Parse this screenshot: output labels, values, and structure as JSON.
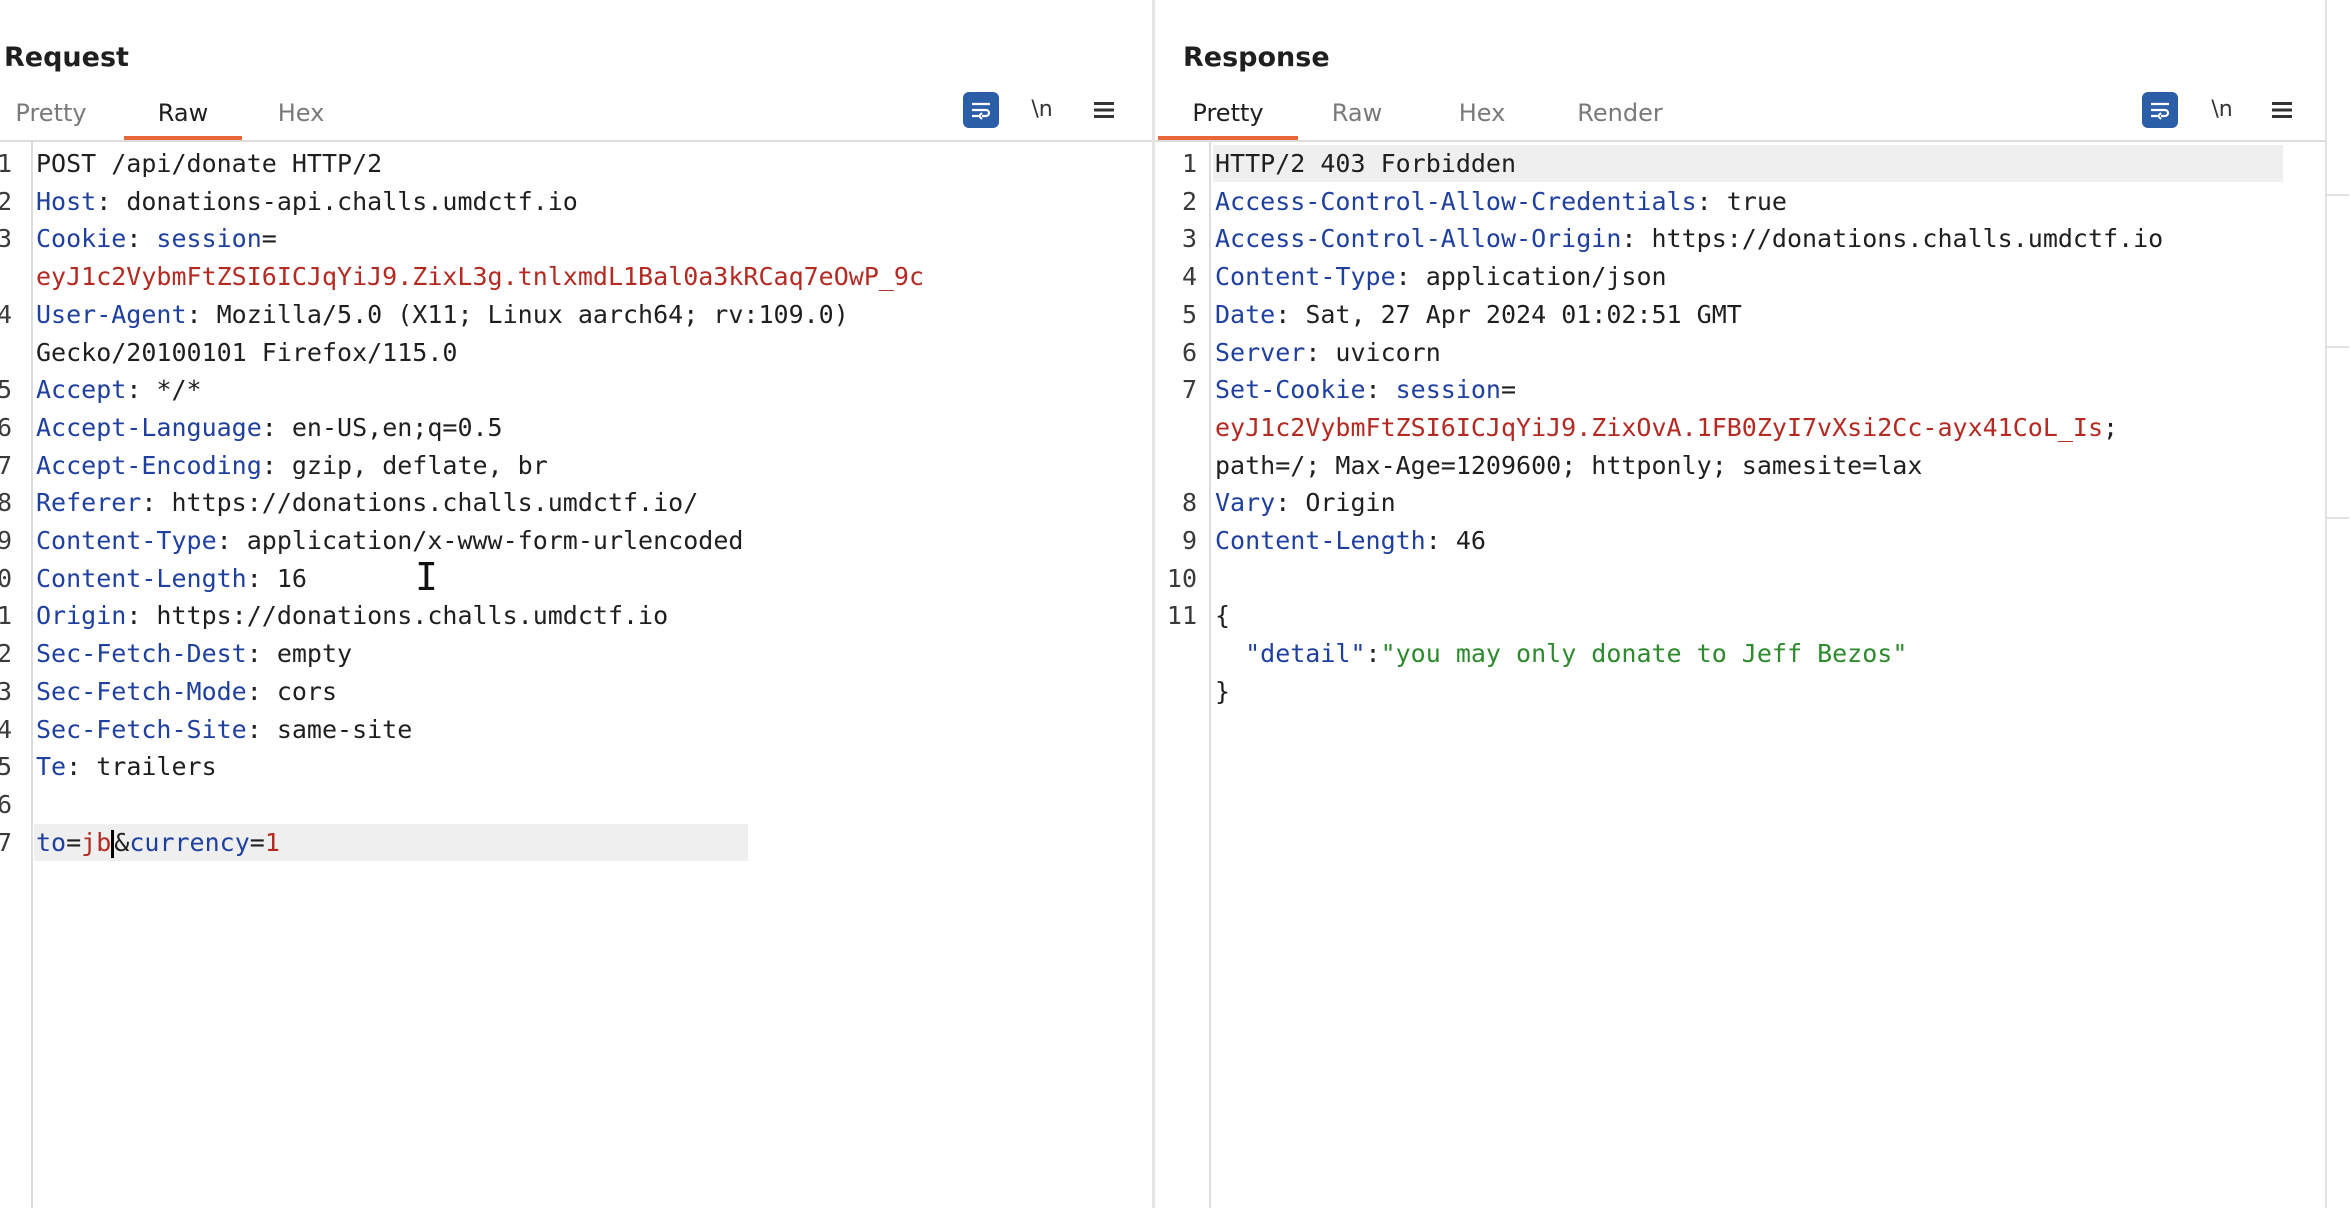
{
  "layout_switch": {
    "options": [
      "side-by-side-layout-icon",
      "stacked-layout-icon",
      "single-pane-layout-icon"
    ],
    "active_index": 0,
    "accent_color": "#2b5ea7"
  },
  "request": {
    "title": "Request",
    "tabs": [
      {
        "label": "Pretty",
        "active": false
      },
      {
        "label": "Raw",
        "active": true
      },
      {
        "label": "Hex",
        "active": false
      }
    ],
    "toolbar": {
      "wrap_icon": "wrap-lines-icon",
      "newline_label": "\\n",
      "menu_icon": "hamburger-menu-icon"
    },
    "lines": [
      {
        "num": "1",
        "segments": [
          {
            "t": "POST /api/donate HTTP/2",
            "c": "v"
          }
        ]
      },
      {
        "num": "2",
        "segments": [
          {
            "t": "Host",
            "c": "k"
          },
          {
            "t": ": donations-api.challs.umdctf.io",
            "c": "v"
          }
        ]
      },
      {
        "num": "3",
        "segments": [
          {
            "t": "Cookie",
            "c": "k"
          },
          {
            "t": ": ",
            "c": "v"
          },
          {
            "t": "session",
            "c": "k"
          },
          {
            "t": "=",
            "c": "v"
          }
        ]
      },
      {
        "num": "",
        "segments": [
          {
            "t": "eyJ1c2VybmFtZSI6ICJqYiJ9.ZixL3g.tnlxmdL1Bal0a3kRCaq7eOwP_9c",
            "c": "r"
          }
        ]
      },
      {
        "num": "4",
        "segments": [
          {
            "t": "User-Agent",
            "c": "k"
          },
          {
            "t": ": Mozilla/5.0 (X11; Linux aarch64; rv:109.0)",
            "c": "v"
          }
        ]
      },
      {
        "num": "",
        "segments": [
          {
            "t": "Gecko/20100101 Firefox/115.0",
            "c": "v"
          }
        ]
      },
      {
        "num": "5",
        "segments": [
          {
            "t": "Accept",
            "c": "k"
          },
          {
            "t": ": */*",
            "c": "v"
          }
        ]
      },
      {
        "num": "6",
        "segments": [
          {
            "t": "Accept-Language",
            "c": "k"
          },
          {
            "t": ": en-US,en;q=0.5",
            "c": "v"
          }
        ]
      },
      {
        "num": "7",
        "segments": [
          {
            "t": "Accept-Encoding",
            "c": "k"
          },
          {
            "t": ": gzip, deflate, br",
            "c": "v"
          }
        ]
      },
      {
        "num": "8",
        "segments": [
          {
            "t": "Referer",
            "c": "k"
          },
          {
            "t": ": https://donations.challs.umdctf.io/",
            "c": "v"
          }
        ]
      },
      {
        "num": "9",
        "segments": [
          {
            "t": "Content-Type",
            "c": "k"
          },
          {
            "t": ": application/x-www-form-urlencoded",
            "c": "v"
          }
        ]
      },
      {
        "num": "0",
        "segments": [
          {
            "t": "Content-Length",
            "c": "k"
          },
          {
            "t": ": 16",
            "c": "v"
          }
        ]
      },
      {
        "num": "1",
        "segments": [
          {
            "t": "Origin",
            "c": "k"
          },
          {
            "t": ": https://donations.challs.umdctf.io",
            "c": "v"
          }
        ]
      },
      {
        "num": "2",
        "segments": [
          {
            "t": "Sec-Fetch-Dest",
            "c": "k"
          },
          {
            "t": ": empty",
            "c": "v"
          }
        ]
      },
      {
        "num": "3",
        "segments": [
          {
            "t": "Sec-Fetch-Mode",
            "c": "k"
          },
          {
            "t": ": cors",
            "c": "v"
          }
        ]
      },
      {
        "num": "4",
        "segments": [
          {
            "t": "Sec-Fetch-Site",
            "c": "k"
          },
          {
            "t": ": same-site",
            "c": "v"
          }
        ]
      },
      {
        "num": "5",
        "segments": [
          {
            "t": "Te",
            "c": "k"
          },
          {
            "t": ": trailers",
            "c": "v"
          }
        ]
      },
      {
        "num": "6",
        "segments": []
      },
      {
        "num": "7",
        "highlight": true,
        "segments": [
          {
            "t": "to",
            "c": "k"
          },
          {
            "t": "=",
            "c": "v"
          },
          {
            "t": "jb",
            "c": "r"
          },
          {
            "t": "&",
            "c": "v",
            "caret_before": true
          },
          {
            "t": "currency",
            "c": "k"
          },
          {
            "t": "=",
            "c": "v"
          },
          {
            "t": "1",
            "c": "r"
          }
        ]
      }
    ]
  },
  "response": {
    "title": "Response",
    "tabs": [
      {
        "label": "Pretty",
        "active": true
      },
      {
        "label": "Raw",
        "active": false
      },
      {
        "label": "Hex",
        "active": false
      },
      {
        "label": "Render",
        "active": false
      }
    ],
    "toolbar": {
      "wrap_icon": "wrap-lines-icon",
      "newline_label": "\\n",
      "menu_icon": "hamburger-menu-icon"
    },
    "lines": [
      {
        "num": "1",
        "highlight": true,
        "segments": [
          {
            "t": "HTTP/2 403 Forbidden",
            "c": "v"
          }
        ]
      },
      {
        "num": "2",
        "segments": [
          {
            "t": "Access-Control-Allow-Credentials",
            "c": "k"
          },
          {
            "t": ": true",
            "c": "v"
          }
        ]
      },
      {
        "num": "3",
        "segments": [
          {
            "t": "Access-Control-Allow-Origin",
            "c": "k"
          },
          {
            "t": ": https://donations.challs.umdctf.io",
            "c": "v"
          }
        ]
      },
      {
        "num": "4",
        "segments": [
          {
            "t": "Content-Type",
            "c": "k"
          },
          {
            "t": ": application/json",
            "c": "v"
          }
        ]
      },
      {
        "num": "5",
        "segments": [
          {
            "t": "Date",
            "c": "k"
          },
          {
            "t": ": Sat, 27 Apr 2024 01:02:51 GMT",
            "c": "v"
          }
        ]
      },
      {
        "num": "6",
        "segments": [
          {
            "t": "Server",
            "c": "k"
          },
          {
            "t": ": uvicorn",
            "c": "v"
          }
        ]
      },
      {
        "num": "7",
        "segments": [
          {
            "t": "Set-Cookie",
            "c": "k"
          },
          {
            "t": ": ",
            "c": "v"
          },
          {
            "t": "session",
            "c": "k"
          },
          {
            "t": "=",
            "c": "v"
          }
        ]
      },
      {
        "num": "",
        "segments": [
          {
            "t": "eyJ1c2VybmFtZSI6ICJqYiJ9.ZixOvA.1FB0ZyI7vXsi2Cc-ayx41CoL_Is",
            "c": "r"
          },
          {
            "t": ";",
            "c": "v"
          }
        ]
      },
      {
        "num": "",
        "segments": [
          {
            "t": "path=/; Max-Age=1209600; httponly; samesite=lax",
            "c": "v"
          }
        ]
      },
      {
        "num": "8",
        "segments": [
          {
            "t": "Vary",
            "c": "k"
          },
          {
            "t": ": Origin",
            "c": "v"
          }
        ]
      },
      {
        "num": "9",
        "segments": [
          {
            "t": "Content-Length",
            "c": "k"
          },
          {
            "t": ": 46",
            "c": "v"
          }
        ]
      },
      {
        "num": "10",
        "segments": []
      },
      {
        "num": "11",
        "segments": [
          {
            "t": "{",
            "c": "v"
          }
        ]
      },
      {
        "num": "",
        "segments": [
          {
            "t": "  \"detail\"",
            "c": "k"
          },
          {
            "t": ":",
            "c": "v"
          },
          {
            "t": "\"you may only donate to Jeff Bezos\"",
            "c": "g"
          }
        ]
      },
      {
        "num": "",
        "segments": [
          {
            "t": "}",
            "c": "v"
          }
        ]
      }
    ]
  }
}
